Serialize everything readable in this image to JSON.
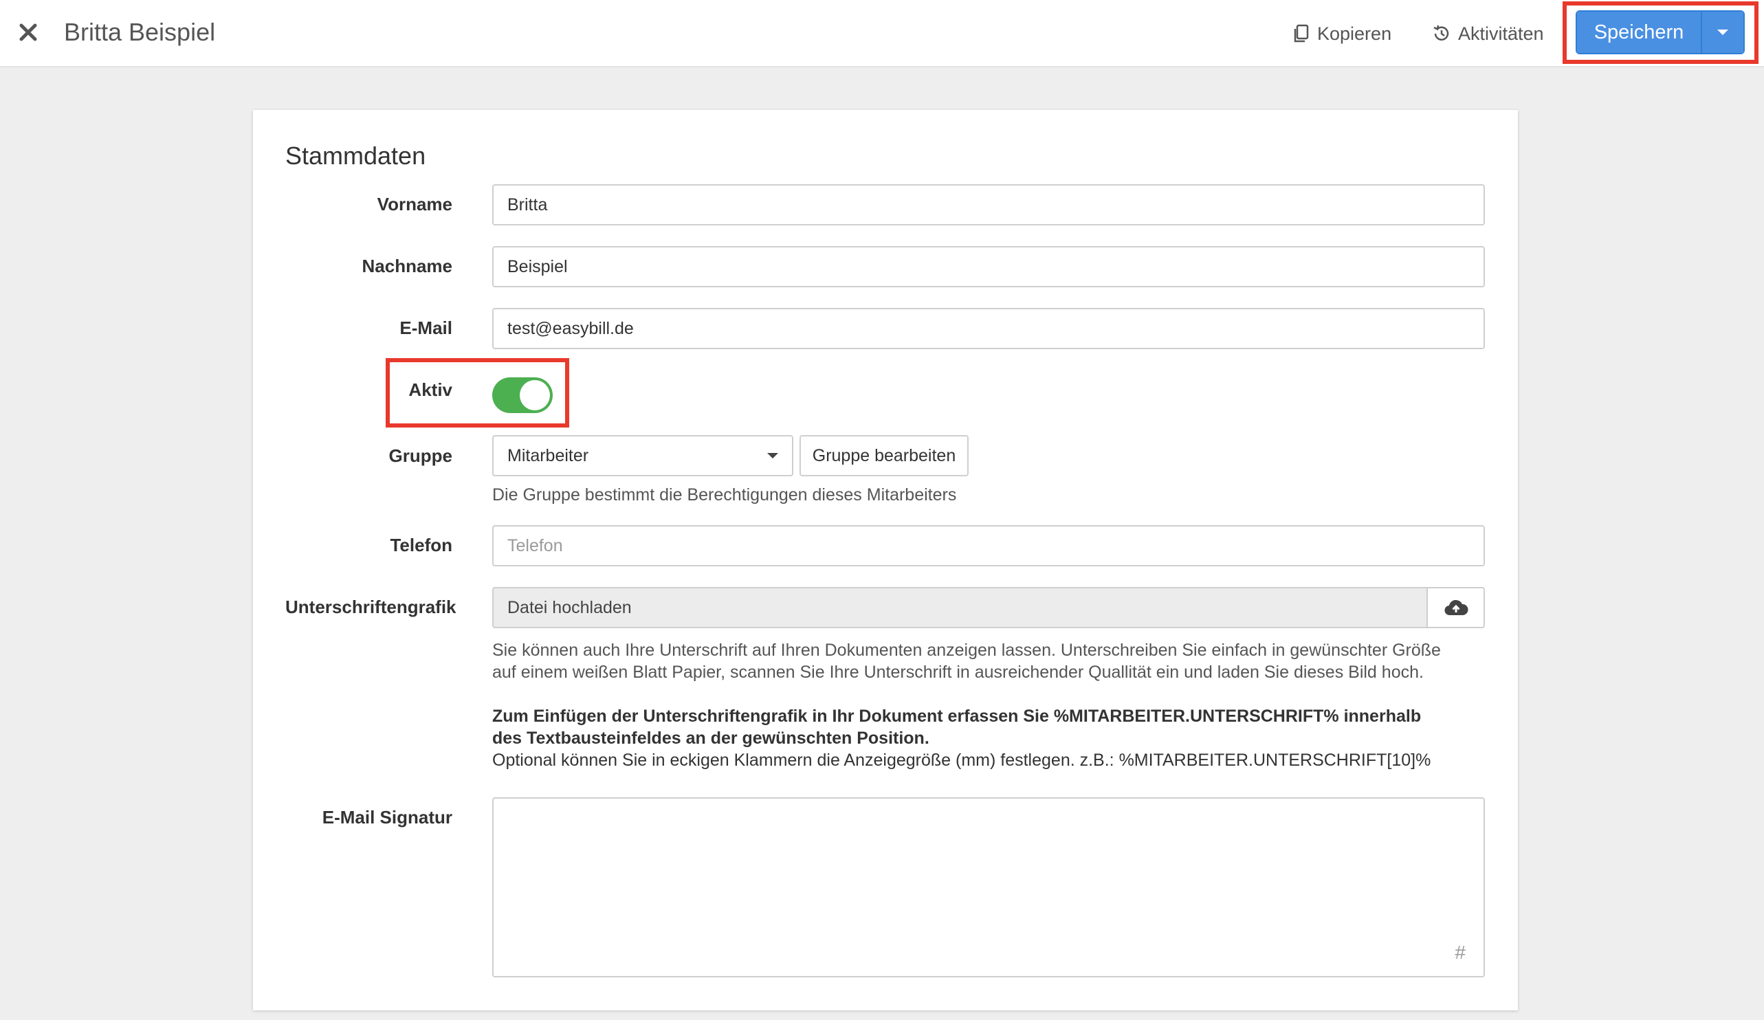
{
  "header": {
    "title": "Britta Beispiel",
    "copy_label": "Kopieren",
    "activities_label": "Aktivitäten",
    "save_label": "Speichern"
  },
  "form": {
    "section_title": "Stammdaten",
    "first_name": {
      "label": "Vorname",
      "value": "Britta"
    },
    "last_name": {
      "label": "Nachname",
      "value": "Beispiel"
    },
    "email": {
      "label": "E-Mail",
      "value": "test@easybill.de"
    },
    "active": {
      "label": "Aktiv",
      "checked": true
    },
    "group": {
      "label": "Gruppe",
      "selected": "Mitarbeiter",
      "edit_button": "Gruppe bearbeiten",
      "help": "Die Gruppe bestimmt die Berechtigungen dieses Mitarbeiters"
    },
    "phone": {
      "label": "Telefon",
      "placeholder": "Telefon"
    },
    "signature_image": {
      "label": "Unterschriftengrafik",
      "file_placeholder": "Datei hochladen",
      "help_line1": "Sie können auch Ihre Unterschrift auf Ihren Dokumenten anzeigen lassen. Unterschreiben Sie einfach in gewünschter Größe",
      "help_line2": "auf einem weißen Blatt Papier, scannen Sie Ihre Unterschrift in ausreichender Quallität ein und laden Sie dieses Bild hoch.",
      "bold_line1": "Zum Einfügen der Unterschriftengrafik in Ihr Dokument erfassen Sie %MITARBEITER.UNTERSCHRIFT% innerhalb",
      "bold_line2": "des Textbausteinfeldes an der gewünschten Position.",
      "optional_line": "Optional können Sie in eckigen Klammern die Anzeigegröße (mm) festlegen. z.B.: %MITARBEITER.UNTERSCHRIFT[10]%"
    },
    "email_signature": {
      "label": "E-Mail Signatur",
      "value": "",
      "placeholder_symbol": "#"
    }
  },
  "colors": {
    "primary": "#4a90e2",
    "toggle_on": "#4caf50",
    "highlight": "#e8392c"
  }
}
